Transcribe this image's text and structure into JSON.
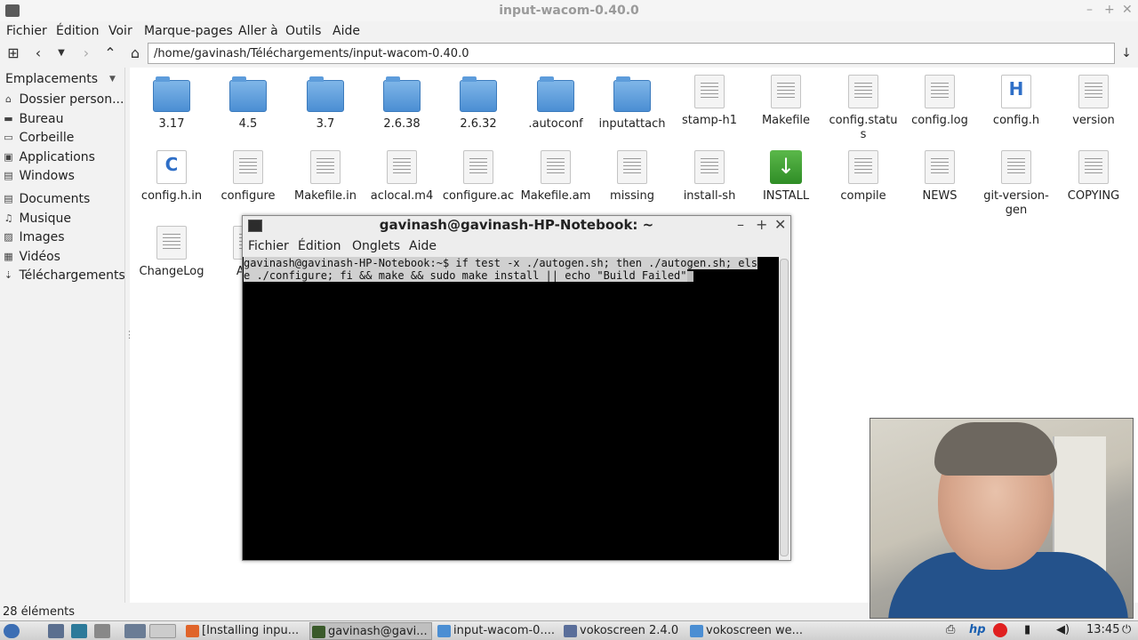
{
  "window": {
    "title": "input-wacom-0.40.0"
  },
  "menubar": [
    "Fichier",
    "Édition",
    "Voir",
    "Marque-pages",
    "Aller à",
    "Outils",
    "Aide"
  ],
  "path": "/home/gavinash/Téléchargements/input-wacom-0.40.0",
  "sidebar": {
    "header": "Emplacements",
    "items": [
      {
        "label": "Dossier person...",
        "icon": "home-icon"
      },
      {
        "label": "Bureau",
        "icon": "desktop-icon"
      },
      {
        "label": "Corbeille",
        "icon": "trash-icon"
      },
      {
        "label": "Applications",
        "icon": "applications-icon"
      },
      {
        "label": "Windows",
        "icon": "drive-icon"
      },
      {
        "label": "Documents",
        "icon": "documents-icon"
      },
      {
        "label": "Musique",
        "icon": "music-icon"
      },
      {
        "label": "Images",
        "icon": "images-icon"
      },
      {
        "label": "Vidéos",
        "icon": "videos-icon"
      },
      {
        "label": "Téléchargements",
        "icon": "downloads-icon"
      }
    ]
  },
  "files": [
    {
      "name": "3.17",
      "type": "folder"
    },
    {
      "name": "4.5",
      "type": "folder"
    },
    {
      "name": "3.7",
      "type": "folder"
    },
    {
      "name": "2.6.38",
      "type": "folder"
    },
    {
      "name": "2.6.32",
      "type": "folder"
    },
    {
      "name": ".autoconf",
      "type": "folder"
    },
    {
      "name": "inputattach",
      "type": "folder"
    },
    {
      "name": "stamp-h1",
      "type": "doc"
    },
    {
      "name": "Makefile",
      "type": "doc"
    },
    {
      "name": "config.statu\ns",
      "type": "doc"
    },
    {
      "name": "config.log",
      "type": "doc"
    },
    {
      "name": "config.h",
      "type": "h"
    },
    {
      "name": "version",
      "type": "doc"
    },
    {
      "name": "config.h.in",
      "type": "c"
    },
    {
      "name": "configure",
      "type": "doc"
    },
    {
      "name": "Makefile.in",
      "type": "doc"
    },
    {
      "name": "aclocal.m4",
      "type": "doc"
    },
    {
      "name": "configure.ac",
      "type": "doc"
    },
    {
      "name": "Makefile.am",
      "type": "doc"
    },
    {
      "name": "missing",
      "type": "doc"
    },
    {
      "name": "install-sh",
      "type": "doc"
    },
    {
      "name": "INSTALL",
      "type": "install"
    },
    {
      "name": "compile",
      "type": "doc"
    },
    {
      "name": "NEWS",
      "type": "doc"
    },
    {
      "name": "git-version-\ngen",
      "type": "doc"
    },
    {
      "name": "COPYING",
      "type": "doc"
    },
    {
      "name": "ChangeLog",
      "type": "doc"
    },
    {
      "name": "AUT",
      "type": "doc"
    }
  ],
  "status": "28 éléments",
  "terminal": {
    "title": "gavinash@gavinash-HP-Notebook: ~",
    "menu": [
      "Fichier",
      "Édition",
      "Onglets",
      "Aide"
    ],
    "prompt": "gavinash@gavinash-HP-Notebook:~$",
    "line1_cmd": " if test -x ./autogen.sh; then ./autogen.sh; els",
    "line2": "e ./configure; fi && make && sudo make install || echo \"Build Failed\""
  },
  "taskbar": {
    "tasks": [
      {
        "label": "[Installing inpu...",
        "color": "#e0642a"
      },
      {
        "label": "gavinash@gavi...",
        "color": "#3a5a2a",
        "active": true
      },
      {
        "label": "input-wacom-0....",
        "color": "#4b8ed3"
      },
      {
        "label": "vokoscreen 2.4.0",
        "color": "#4b8ed3"
      },
      {
        "label": "vokoscreen we...",
        "color": "#4b8ed3"
      }
    ],
    "clock": "13:45"
  },
  "colors": {
    "folder": "#4b8ed3",
    "terminal_bg": "#000000",
    "selection": "#d0d0d0"
  }
}
